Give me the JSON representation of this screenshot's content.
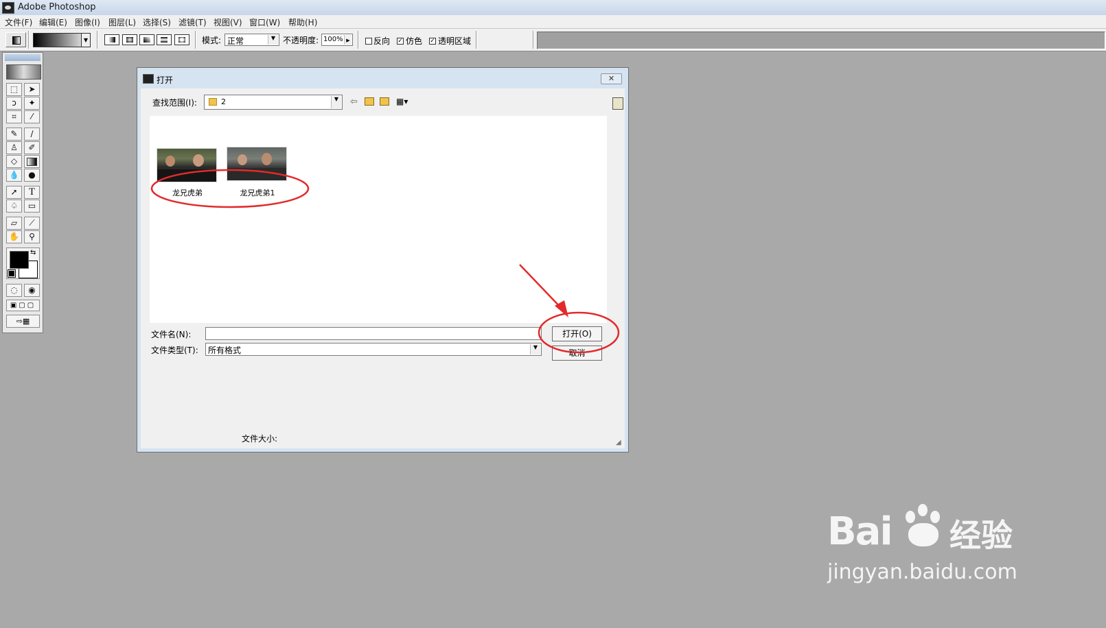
{
  "app": {
    "title": "Adobe Photoshop"
  },
  "menu": [
    {
      "label": "文件(F)"
    },
    {
      "label": "编辑(E)"
    },
    {
      "label": "图像(I)"
    },
    {
      "label": "图层(L)"
    },
    {
      "label": "选择(S)"
    },
    {
      "label": "滤镜(T)"
    },
    {
      "label": "视图(V)"
    },
    {
      "label": "窗口(W)"
    },
    {
      "label": "帮助(H)"
    }
  ],
  "options": {
    "mode_label": "模式:",
    "mode_value": "正常",
    "opacity_label": "不透明度:",
    "opacity_value": "100%",
    "reverse_label": "反向",
    "dither_label": "仿色",
    "transparency_label": "透明区域",
    "checks": {
      "reverse": false,
      "dither": true,
      "transparency": true
    }
  },
  "dialog": {
    "title": "打开",
    "close_glyph": "✕",
    "look_in_label": "查找范围(I):",
    "look_in_value": "2",
    "files": [
      {
        "name": "龙兄虎弟"
      },
      {
        "name": "龙兄虎弟1"
      }
    ],
    "filename_label": "文件名(N):",
    "filename_value": "",
    "filetype_label": "文件类型(T):",
    "filetype_value": "所有格式",
    "open_button": "打开(O)",
    "cancel_button": "取消",
    "filesize_label": "文件大小:"
  },
  "icons": {
    "back": "back-arrow-icon",
    "up": "up-folder-icon",
    "new_folder": "new-folder-icon",
    "view_menu": "view-menu-icon",
    "folder": "folder-icon"
  },
  "annotation_color": "#e32a2a",
  "watermark": {
    "brand_left": "Bai",
    "brand_right": "经验",
    "url": "jingyan.baidu.com"
  }
}
